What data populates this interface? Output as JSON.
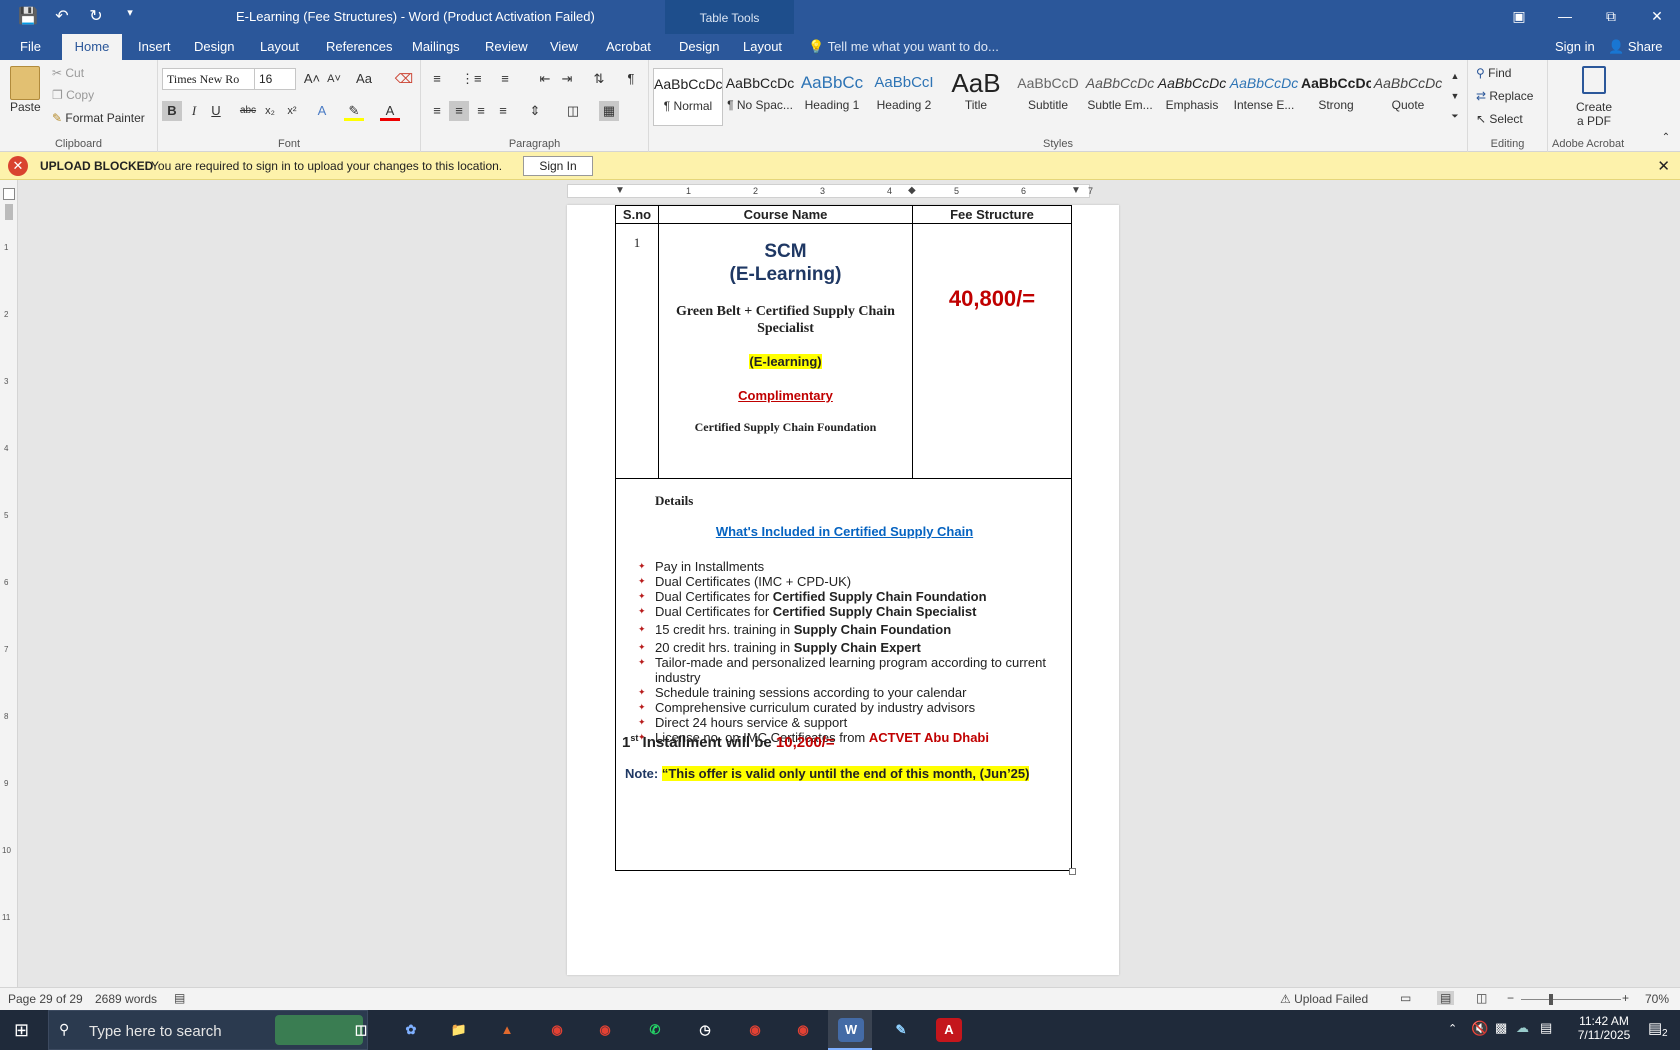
{
  "window": {
    "title": "E-Learning (Fee Structures) - Word (Product Activation Failed)",
    "table_tools": "Table Tools",
    "restore_icon": "restore-icon",
    "min_icon": "minimize-icon"
  },
  "tabs": {
    "file": "File",
    "home": "Home",
    "insert": "Insert",
    "design": "Design",
    "layout": "Layout",
    "references": "References",
    "mailings": "Mailings",
    "review": "Review",
    "view": "View",
    "acrobat": "Acrobat",
    "tt_design": "Design",
    "tt_layout": "Layout",
    "tellme": "Tell me what you want to do...",
    "signin": "Sign in",
    "share": "Share"
  },
  "ribbon": {
    "paste": "Paste",
    "cut": "Cut",
    "copy": "Copy",
    "format_painter": "Format Painter",
    "clipboard": "Clipboard",
    "font_name": "Times New Ro",
    "font_size": "16",
    "font": "Font",
    "bold": "B",
    "italic": "I",
    "underline": "U",
    "paragraph": "Paragraph",
    "styles": "Styles",
    "find": "Find",
    "replace": "Replace",
    "select": "Select",
    "editing": "Editing",
    "create_pdf_1": "Create",
    "create_pdf_2": "a PDF",
    "adobe_acrobat": "Adobe Acrobat",
    "style_items": [
      {
        "preview": "AaBbCcDc",
        "name": "¶ Normal"
      },
      {
        "preview": "AaBbCcDc",
        "name": "¶ No Spac..."
      },
      {
        "preview": "AaBbCc",
        "name": "Heading 1"
      },
      {
        "preview": "AaBbCcI",
        "name": "Heading 2"
      },
      {
        "preview": "AaB",
        "name": "Title"
      },
      {
        "preview": "AaBbCcD",
        "name": "Subtitle"
      },
      {
        "preview": "AaBbCcDc",
        "name": "Subtle Em..."
      },
      {
        "preview": "AaBbCcDc",
        "name": "Emphasis"
      },
      {
        "preview": "AaBbCcDc",
        "name": "Intense E..."
      },
      {
        "preview": "AaBbCcDc",
        "name": "Strong"
      },
      {
        "preview": "AaBbCcDc",
        "name": "Quote"
      }
    ]
  },
  "message_bar": {
    "title": "UPLOAD BLOCKED",
    "text": "You are required to sign in to upload your changes to this location.",
    "button": "Sign In"
  },
  "ruler": {
    "marks": [
      "1",
      "2",
      "3",
      "4",
      "5",
      "6",
      "7"
    ]
  },
  "vruler": {
    "marks": [
      "1",
      "2",
      "3",
      "4",
      "5",
      "6",
      "7",
      "8",
      "9",
      "10",
      "11"
    ]
  },
  "document": {
    "headers": [
      "S.no",
      "Course Name",
      "Fee Structure"
    ],
    "row": {
      "sno": "1",
      "course_line1": "SCM",
      "course_line2": "(E-Learning)",
      "course_title": "Green Belt + Certified Supply Chain Specialist",
      "elearning_tag": "(E-learning)",
      "complimentary": "Complimentary",
      "foundation": "Certified Supply Chain Foundation",
      "fee": "40,800/="
    },
    "details": {
      "heading": "Details",
      "link": "What's Included in Certified Supply Chain",
      "bullets": [
        {
          "text": "Pay in Installments",
          "bold": ""
        },
        {
          "text": "Dual Certificates (IMC + CPD-UK)",
          "bold": ""
        },
        {
          "text": "Dual Certificates for ",
          "bold": "Certified Supply Chain Foundation"
        },
        {
          "text": "Dual Certificates for ",
          "bold": "Certified Supply Chain Specialist"
        },
        {
          "text": "15 credit hrs. training in ",
          "bold": "Supply Chain Foundation"
        },
        {
          "text": "20 credit hrs. training in ",
          "bold": "Supply Chain Expert"
        },
        {
          "text": "Tailor-made and personalized learning program according to current industry",
          "bold": ""
        },
        {
          "text": "Schedule training sessions according to your calendar",
          "bold": ""
        },
        {
          "text": "Comprehensive curriculum curated by industry advisors",
          "bold": ""
        },
        {
          "text": "Direct 24 hours service & support",
          "bold": ""
        },
        {
          "text": "License no. on IMC Certificates from ",
          "red": "ACTVET Abu Dhabi"
        }
      ],
      "installment_num": "1",
      "installment_sup": "st",
      "installment_text": " Installment will be ",
      "installment_amount": "10,200/=",
      "note_label": "Note:",
      "note_text": "“This offer is valid only until the end of this month, (Jun’25)"
    }
  },
  "status": {
    "page": "Page 29 of 29",
    "words": "2689 words",
    "upload": "Upload Failed",
    "zoom": "70%"
  },
  "taskbar": {
    "search": "Type here to search",
    "time": "11:42 AM",
    "date": "7/11/2025",
    "notif": "2"
  }
}
